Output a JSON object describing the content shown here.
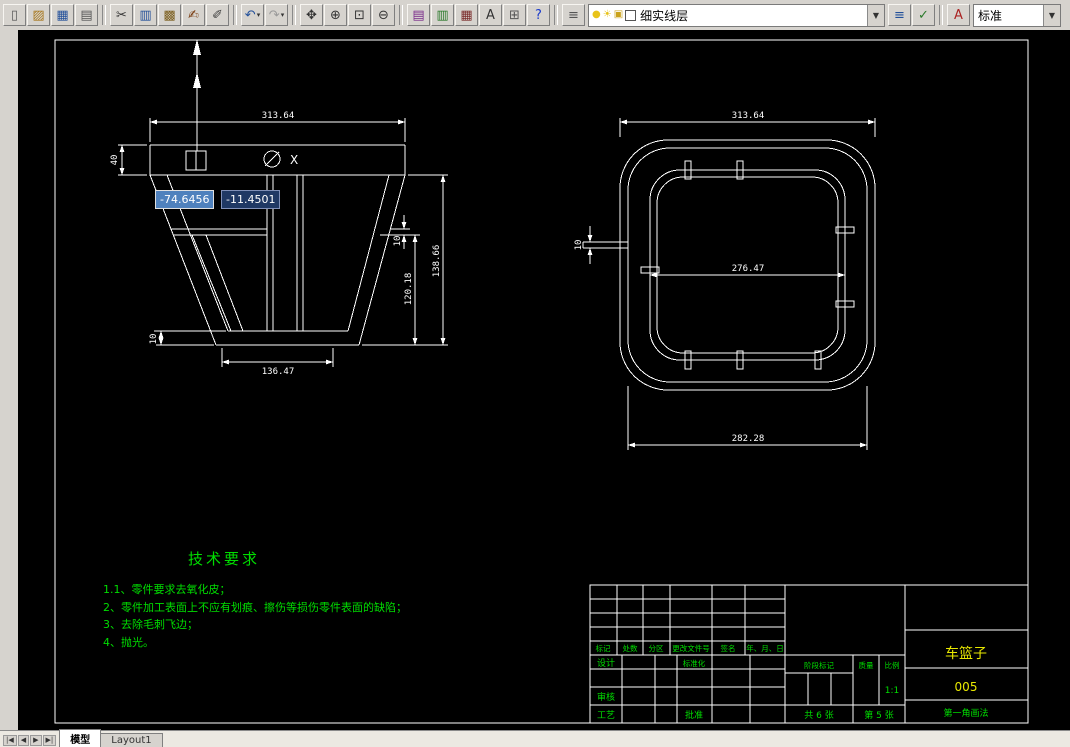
{
  "colors": {
    "canvas_bg": "#000000",
    "line": "#ffffff",
    "note_green": "#00dd00",
    "title_yellow": "#e8e800",
    "tooltip_active": "#4f81bd",
    "tooltip_inactive": "#1f3864",
    "chrome": "#d6d3ce"
  },
  "toolbar": {
    "buttons": [
      {
        "name": "new-drawing",
        "glyph": "▯",
        "color": "#5a5a5a"
      },
      {
        "name": "open-drawing",
        "glyph": "▨",
        "color": "#a8781e"
      },
      {
        "name": "save-drawing",
        "glyph": "▦",
        "color": "#23509a"
      },
      {
        "name": "plot",
        "glyph": "▤",
        "color": "#555555"
      },
      {
        "sep": true
      },
      {
        "name": "cut-to-clipboard",
        "glyph": "✂",
        "color": "#333333"
      },
      {
        "name": "copy-to-clipboard",
        "glyph": "▥",
        "color": "#23509a"
      },
      {
        "name": "paste-from-clipboard",
        "glyph": "▩",
        "color": "#7a5c1a"
      },
      {
        "name": "match-properties",
        "glyph": "✍",
        "color": "#7a3c10"
      },
      {
        "name": "erase",
        "glyph": "✐",
        "color": "#444444"
      },
      {
        "sep": true
      },
      {
        "name": "undo",
        "glyph": "↶",
        "color": "#23509a",
        "caret": true
      },
      {
        "name": "redo",
        "glyph": "↷",
        "color": "#9a9a9a",
        "caret": true
      },
      {
        "sep": true
      },
      {
        "name": "pan-realtime",
        "glyph": "✥",
        "color": "#333333"
      },
      {
        "name": "zoom-realtime",
        "glyph": "⊕",
        "color": "#333333"
      },
      {
        "name": "zoom-window",
        "glyph": "⊡",
        "color": "#333333"
      },
      {
        "name": "zoom-previous",
        "glyph": "⊖",
        "color": "#333333"
      },
      {
        "sep": true
      },
      {
        "name": "layer-properties-manager",
        "glyph": "▤",
        "color": "#7a2a8a"
      },
      {
        "name": "object-properties",
        "glyph": "▥",
        "color": "#2a7a2a"
      },
      {
        "name": "design-center",
        "glyph": "▦",
        "color": "#7a2a2a"
      },
      {
        "name": "text-window",
        "glyph": "A",
        "color": "#333333"
      },
      {
        "name": "quick-calc",
        "glyph": "⊞",
        "color": "#555555"
      },
      {
        "name": "help",
        "glyph": "?",
        "color": "#1a3acc"
      },
      {
        "sep": true
      },
      {
        "name": "layers",
        "glyph": "≡",
        "color": "#555555"
      }
    ],
    "layer_combo": {
      "value": "细实线层",
      "icons": [
        {
          "name": "layer-on-bulb-icon",
          "glyph": "●",
          "color": "#e8c31a"
        },
        {
          "name": "layer-thaw-sun-icon",
          "glyph": "☀",
          "color": "#e8c31a"
        },
        {
          "name": "layer-lock-icon",
          "glyph": "▣",
          "color": "#caa21a"
        },
        {
          "name": "layer-color-swatch-icon",
          "glyph": "■",
          "color": "#ffffff",
          "swatch": true
        }
      ]
    },
    "right_buttons": [
      {
        "name": "layer-states",
        "glyph": "≡",
        "color": "#23509a"
      },
      {
        "name": "make-object-layer-current",
        "glyph": "✓",
        "color": "#2a7a2a"
      },
      {
        "sep": true
      },
      {
        "name": "text-style",
        "glyph": "A",
        "color": "#aa2222"
      }
    ],
    "style_combo": {
      "value": "标准"
    }
  },
  "drawing": {
    "front_view": {
      "dim_width_top": "313.64",
      "dim_flange_height": "40",
      "dim_total_height": "138.66",
      "dim_inner_height": "120.18",
      "dim_wall_top": "10",
      "dim_bottom_width": "136.47",
      "dim_wall_bottom": "10",
      "datum_label": "X"
    },
    "top_view": {
      "dim_width_top": "313.64",
      "dim_inner_width": "276.47",
      "dim_bottom_width": "282.28",
      "dim_rim": "10"
    },
    "dynamic_input": {
      "x": "-74.6456",
      "y": "-11.4501"
    }
  },
  "tech_requirements": {
    "title": "技术要求",
    "items": [
      "1.1、零件要求去氧化皮；",
      "2、零件加工表面上不应有划痕、擦伤等损伤零件表面的缺陷；",
      "3、去除毛刺飞边；",
      "4、抛光。"
    ]
  },
  "title_block": {
    "rev_headers": [
      "标记",
      "处数",
      "分区",
      "更改文件号",
      "签名",
      "年、月、日"
    ],
    "design_label": "设计",
    "standardization_label": "标准化",
    "check_label": "审核",
    "process_label": "工艺",
    "approve_label": "批准",
    "stage_label": "阶段标记",
    "mass_label": "质量",
    "scale_label": "比例",
    "scale_value": "1:1",
    "sheets_total": "共 6 张",
    "sheet_number": "第 5 张",
    "part_name": "车篮子",
    "drawing_number": "005",
    "projection_method": "第一角画法"
  },
  "tabs": {
    "nav": [
      "|◀",
      "◀",
      "▶",
      "▶|"
    ],
    "items": [
      {
        "label": "模型",
        "active": true
      },
      {
        "label": "Layout1",
        "active": false
      }
    ]
  }
}
